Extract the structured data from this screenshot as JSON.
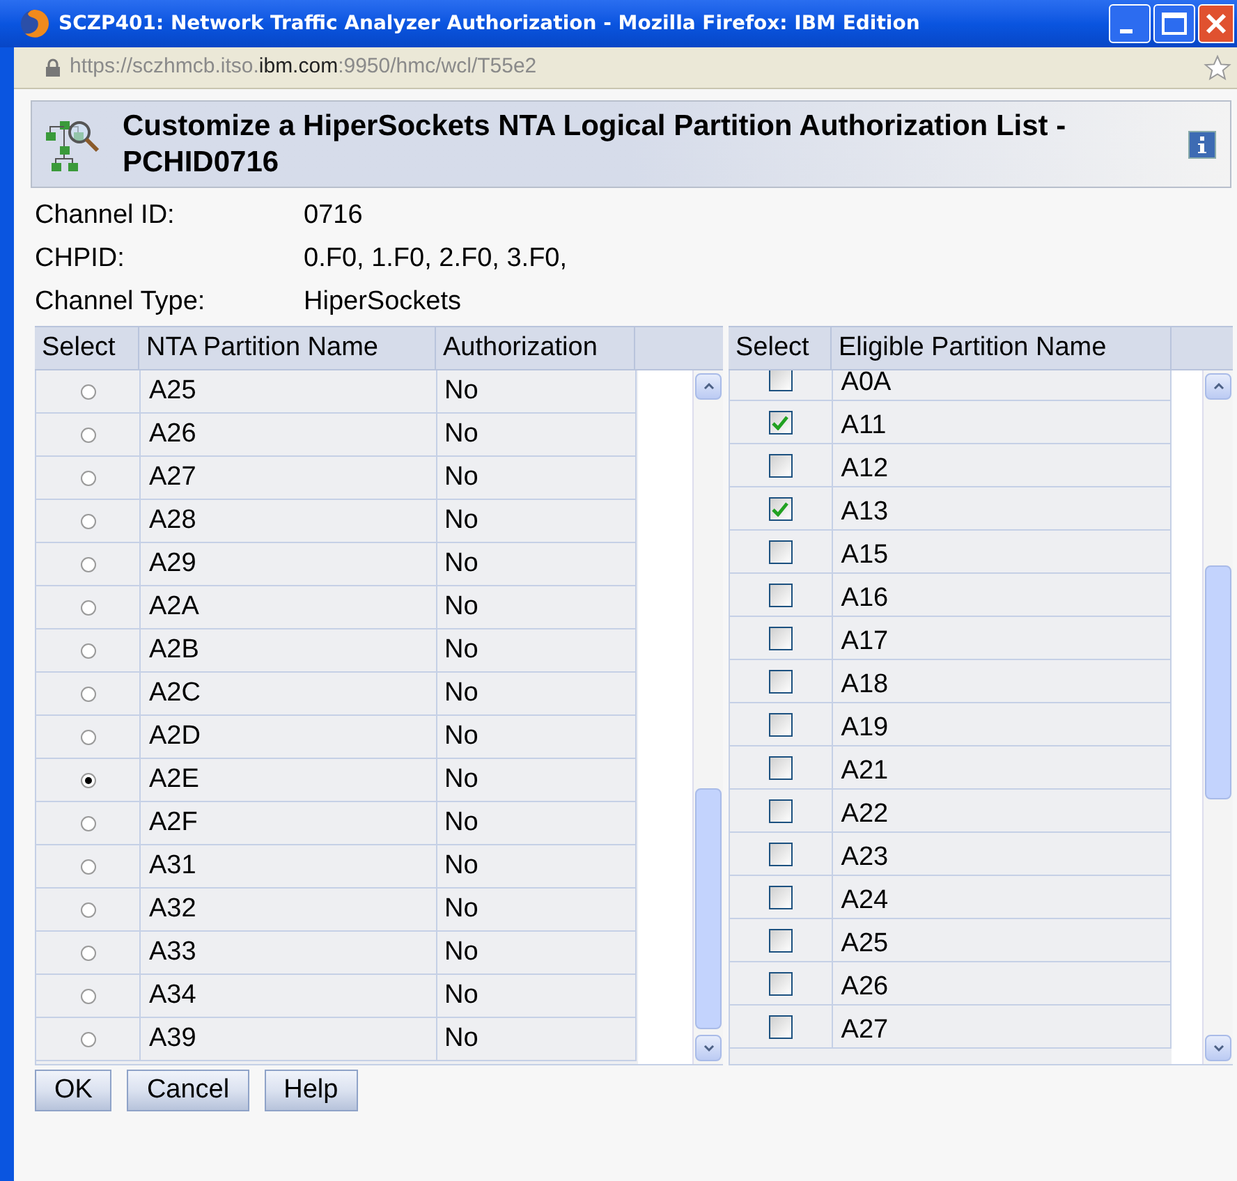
{
  "window": {
    "title": "SCZP401: Network Traffic Analyzer Authorization - Mozilla Firefox: IBM Edition"
  },
  "url": {
    "prefix": "https://sczhmcb.itso.",
    "domain": "ibm.com",
    "suffix": ":9950/hmc/wcl/T55e2"
  },
  "header": {
    "title": "Customize a HiperSockets NTA Logical Partition Authorization List - PCHID0716"
  },
  "info": [
    {
      "label": "Channel ID:",
      "value": "0716"
    },
    {
      "label": "CHPID:",
      "value": "0.F0, 1.F0, 2.F0, 3.F0,"
    },
    {
      "label": "Channel Type:",
      "value": "HiperSockets"
    }
  ],
  "nta_table": {
    "columns": [
      "Select",
      "NTA Partition Name",
      "Authorization"
    ],
    "rows": [
      {
        "name": "A25",
        "authorization": "No",
        "selected": false
      },
      {
        "name": "A26",
        "authorization": "No",
        "selected": false
      },
      {
        "name": "A27",
        "authorization": "No",
        "selected": false
      },
      {
        "name": "A28",
        "authorization": "No",
        "selected": false
      },
      {
        "name": "A29",
        "authorization": "No",
        "selected": false
      },
      {
        "name": "A2A",
        "authorization": "No",
        "selected": false
      },
      {
        "name": "A2B",
        "authorization": "No",
        "selected": false
      },
      {
        "name": "A2C",
        "authorization": "No",
        "selected": false
      },
      {
        "name": "A2D",
        "authorization": "No",
        "selected": false
      },
      {
        "name": "A2E",
        "authorization": "No",
        "selected": true
      },
      {
        "name": "A2F",
        "authorization": "No",
        "selected": false
      },
      {
        "name": "A31",
        "authorization": "No",
        "selected": false
      },
      {
        "name": "A32",
        "authorization": "No",
        "selected": false
      },
      {
        "name": "A33",
        "authorization": "No",
        "selected": false
      },
      {
        "name": "A34",
        "authorization": "No",
        "selected": false
      },
      {
        "name": "A39",
        "authorization": "No",
        "selected": false
      }
    ]
  },
  "eligible_table": {
    "columns": [
      "Select",
      "Eligible Partition Name"
    ],
    "rows": [
      {
        "name": "A0A",
        "checked": false
      },
      {
        "name": "A11",
        "checked": true
      },
      {
        "name": "A12",
        "checked": false
      },
      {
        "name": "A13",
        "checked": true
      },
      {
        "name": "A15",
        "checked": false
      },
      {
        "name": "A16",
        "checked": false
      },
      {
        "name": "A17",
        "checked": false
      },
      {
        "name": "A18",
        "checked": false
      },
      {
        "name": "A19",
        "checked": false
      },
      {
        "name": "A21",
        "checked": false
      },
      {
        "name": "A22",
        "checked": false
      },
      {
        "name": "A23",
        "checked": false
      },
      {
        "name": "A24",
        "checked": false
      },
      {
        "name": "A25",
        "checked": false
      },
      {
        "name": "A26",
        "checked": false
      },
      {
        "name": "A27",
        "checked": false
      }
    ]
  },
  "buttons": [
    "OK",
    "Cancel",
    "Help"
  ]
}
